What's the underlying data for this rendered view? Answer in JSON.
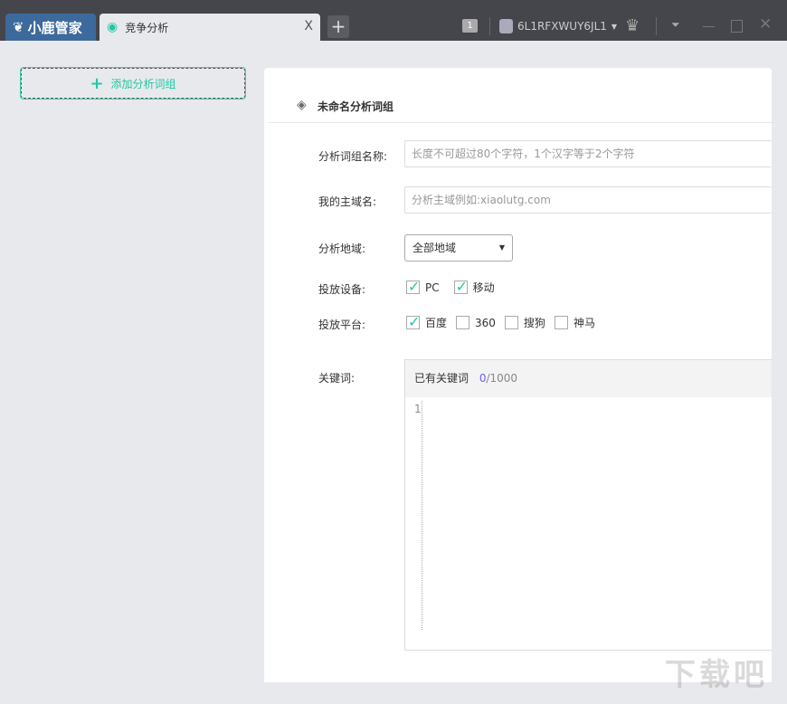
{
  "titlebar": {
    "app_name": "小鹿管家",
    "tab_label": "竞争分析",
    "tab_close": "X",
    "new_tab": "+",
    "badge": "1",
    "username": "6L1RFXWUY6JL1"
  },
  "sidebar": {
    "add_group_label": "添加分析词组"
  },
  "form": {
    "group_title": "未命名分析词组",
    "name_label": "分析词组名称:",
    "name_placeholder": "长度不可超过80个字符，1个汉字等于2个字符",
    "domain_label": "我的主域名:",
    "domain_placeholder": "分析主域例如:xiaolutg.com",
    "region_label": "分析地域:",
    "region_value": "全部地域",
    "device_label": "投放设备:",
    "devices": [
      {
        "label": "PC",
        "checked": true
      },
      {
        "label": "移动",
        "checked": true
      }
    ],
    "platform_label": "投放平台:",
    "platforms": [
      {
        "label": "百度",
        "checked": true
      },
      {
        "label": "360",
        "checked": false
      },
      {
        "label": "搜狗",
        "checked": false
      },
      {
        "label": "神马",
        "checked": false
      }
    ],
    "keywords_label": "关键词:",
    "keywords_header": "已有关键词",
    "keywords_count": "0",
    "keywords_max": "/1000",
    "line_number": "1"
  },
  "watermark": "下载吧 www.xiazaiba.com"
}
